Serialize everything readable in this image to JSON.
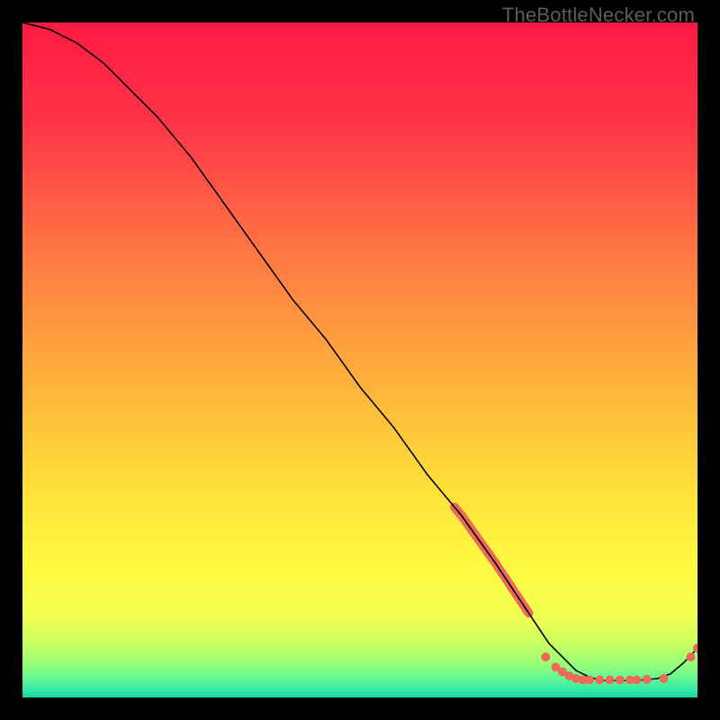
{
  "watermark": "TheBottleNecker.com",
  "gradient_stops": [
    {
      "offset": 0.0,
      "color": "#ff1a43"
    },
    {
      "offset": 0.15,
      "color": "#ff3448"
    },
    {
      "offset": 0.35,
      "color": "#ff7a42"
    },
    {
      "offset": 0.55,
      "color": "#ffb63a"
    },
    {
      "offset": 0.7,
      "color": "#ffe33a"
    },
    {
      "offset": 0.8,
      "color": "#fff83f"
    },
    {
      "offset": 0.88,
      "color": "#f2ff52"
    },
    {
      "offset": 0.92,
      "color": "#c9ff60"
    },
    {
      "offset": 0.95,
      "color": "#99ff78"
    },
    {
      "offset": 0.975,
      "color": "#5cf797"
    },
    {
      "offset": 0.99,
      "color": "#2de8a5"
    },
    {
      "offset": 1.0,
      "color": "#15d49f"
    }
  ],
  "chart_data": {
    "type": "line",
    "title": "",
    "xlabel": "",
    "ylabel": "",
    "xlim": [
      0,
      100
    ],
    "ylim": [
      0,
      100
    ],
    "series": [
      {
        "name": "bottleneck-curve",
        "color": "#000000",
        "x": [
          0,
          4,
          8,
          12,
          16,
          20,
          25,
          30,
          35,
          40,
          45,
          50,
          55,
          60,
          65,
          70,
          72,
          74,
          76,
          78,
          80,
          82,
          84,
          86,
          88,
          90,
          92,
          94,
          96,
          98,
          100
        ],
        "y": [
          100,
          99,
          97,
          94,
          90,
          86,
          80,
          73,
          66,
          59,
          53,
          46,
          40,
          33,
          27,
          20,
          17,
          14,
          11,
          8,
          6,
          4,
          3,
          2.5,
          2.5,
          2.5,
          2.6,
          2.8,
          3.5,
          5.2,
          7.3
        ]
      }
    ],
    "short_segments": [
      {
        "name": "upper-tick-cluster",
        "color": "#ec6a5a",
        "x_range": [
          64,
          67
        ],
        "y_range": [
          22,
          29
        ]
      },
      {
        "name": "mid-tick-cluster",
        "color": "#ec6a5a",
        "x_range": [
          67,
          71
        ],
        "y_range": [
          15,
          22
        ]
      },
      {
        "name": "lower-tick-cluster",
        "color": "#ec6a5a",
        "x_range": [
          71,
          75
        ],
        "y_range": [
          9,
          15
        ]
      }
    ],
    "points": [
      {
        "x": 77.5,
        "y": 6.0
      },
      {
        "x": 79.0,
        "y": 4.5
      },
      {
        "x": 80.0,
        "y": 3.8
      },
      {
        "x": 81.0,
        "y": 3.2
      },
      {
        "x": 82.0,
        "y": 2.8
      },
      {
        "x": 83.0,
        "y": 2.6
      },
      {
        "x": 84.0,
        "y": 2.6
      },
      {
        "x": 85.5,
        "y": 2.6
      },
      {
        "x": 87.0,
        "y": 2.6
      },
      {
        "x": 88.5,
        "y": 2.6
      },
      {
        "x": 90.0,
        "y": 2.6
      },
      {
        "x": 91.0,
        "y": 2.6
      },
      {
        "x": 92.5,
        "y": 2.7
      },
      {
        "x": 95.0,
        "y": 2.8
      },
      {
        "x": 99.0,
        "y": 6.0
      },
      {
        "x": 100.0,
        "y": 7.3
      }
    ],
    "point_style": {
      "color": "#ec6a5a",
      "radius_px": 5
    }
  }
}
